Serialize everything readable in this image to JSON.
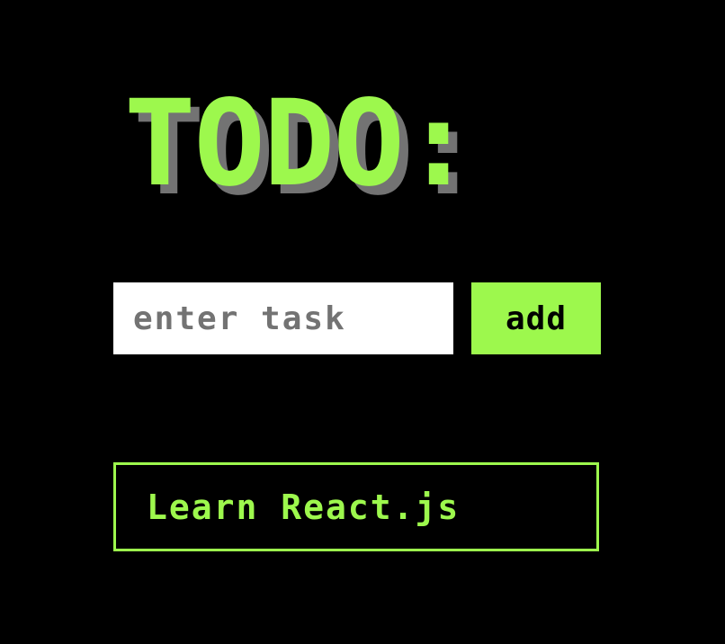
{
  "header": {
    "title": "TODO:"
  },
  "form": {
    "input_placeholder": "enter task",
    "input_value": "",
    "add_label": "add"
  },
  "tasks": [
    {
      "text": "Learn React.js"
    }
  ],
  "colors": {
    "background": "#000000",
    "accent": "#9df84d",
    "shadow": "#737373",
    "input_background": "#ffffff",
    "input_text": "#737373"
  }
}
